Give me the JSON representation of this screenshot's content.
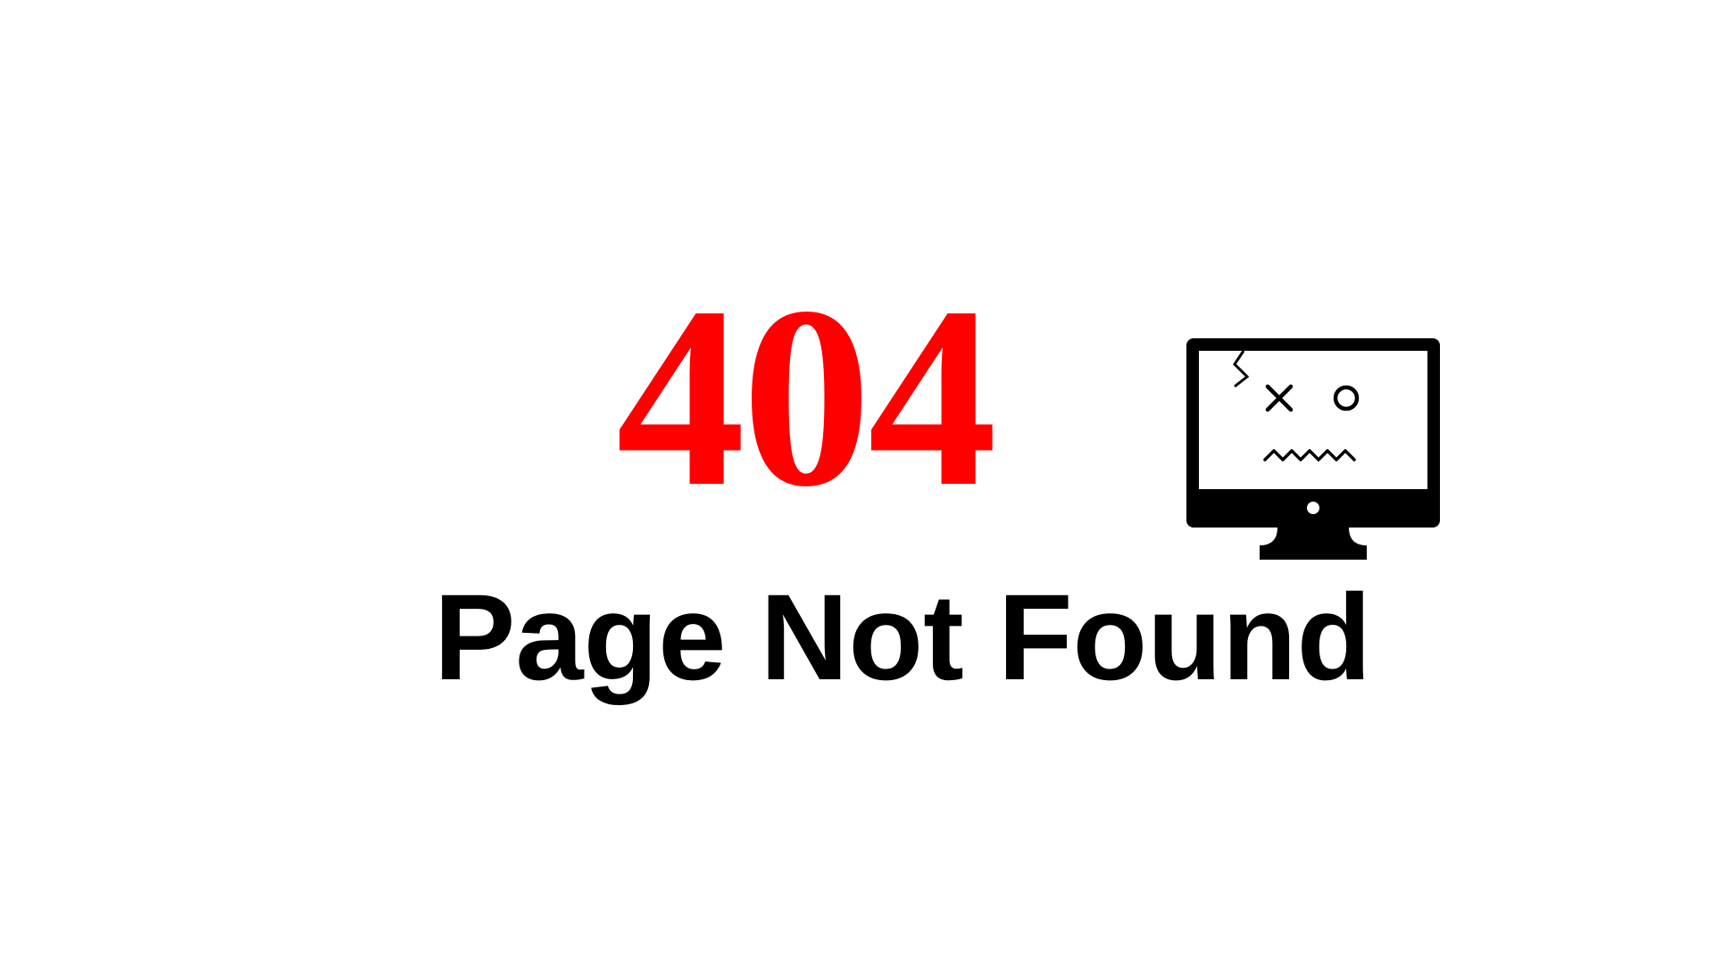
{
  "error": {
    "code": "404",
    "message": "Page Not Found"
  },
  "illustration": {
    "icon": "broken-monitor-icon"
  },
  "colors": {
    "background": "#ffffff",
    "code": "#ff0000",
    "message": "#000000",
    "icon": "#000000"
  }
}
